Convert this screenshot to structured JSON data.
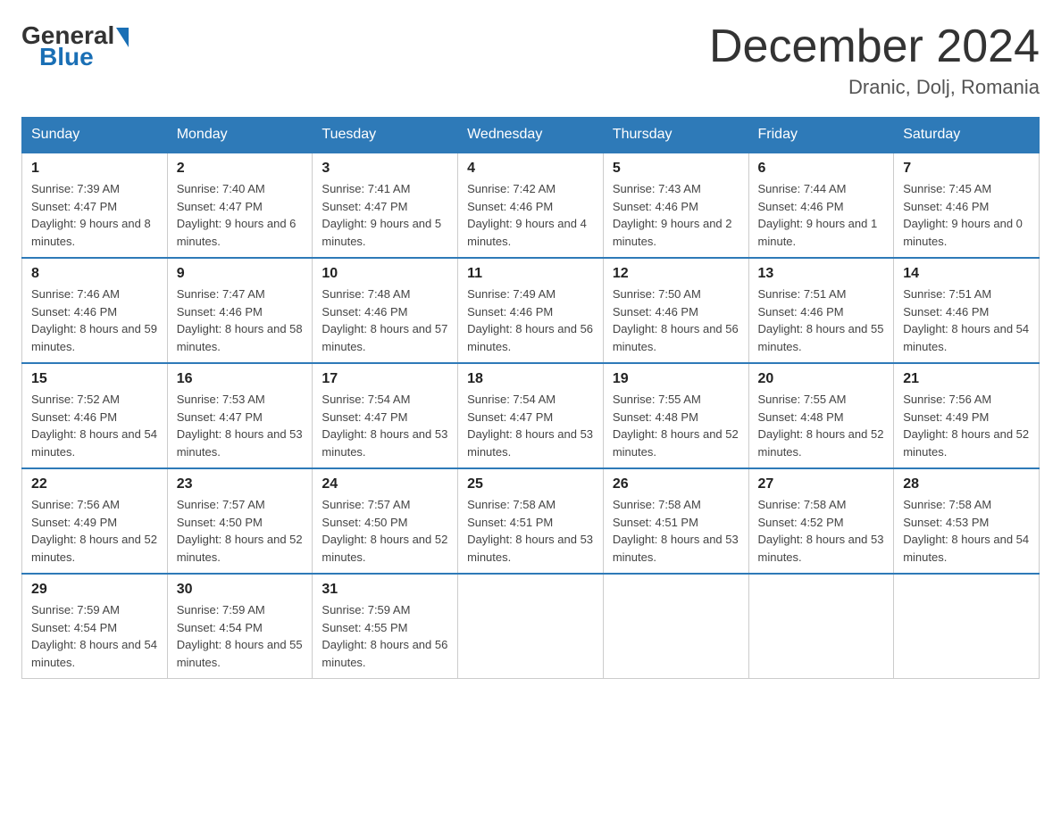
{
  "header": {
    "logo_general": "General",
    "logo_blue": "Blue",
    "month_year": "December 2024",
    "location": "Dranic, Dolj, Romania"
  },
  "weekdays": [
    "Sunday",
    "Monday",
    "Tuesday",
    "Wednesday",
    "Thursday",
    "Friday",
    "Saturday"
  ],
  "weeks": [
    [
      {
        "day": "1",
        "sunrise": "7:39 AM",
        "sunset": "4:47 PM",
        "daylight": "9 hours and 8 minutes."
      },
      {
        "day": "2",
        "sunrise": "7:40 AM",
        "sunset": "4:47 PM",
        "daylight": "9 hours and 6 minutes."
      },
      {
        "day": "3",
        "sunrise": "7:41 AM",
        "sunset": "4:47 PM",
        "daylight": "9 hours and 5 minutes."
      },
      {
        "day": "4",
        "sunrise": "7:42 AM",
        "sunset": "4:46 PM",
        "daylight": "9 hours and 4 minutes."
      },
      {
        "day": "5",
        "sunrise": "7:43 AM",
        "sunset": "4:46 PM",
        "daylight": "9 hours and 2 minutes."
      },
      {
        "day": "6",
        "sunrise": "7:44 AM",
        "sunset": "4:46 PM",
        "daylight": "9 hours and 1 minute."
      },
      {
        "day": "7",
        "sunrise": "7:45 AM",
        "sunset": "4:46 PM",
        "daylight": "9 hours and 0 minutes."
      }
    ],
    [
      {
        "day": "8",
        "sunrise": "7:46 AM",
        "sunset": "4:46 PM",
        "daylight": "8 hours and 59 minutes."
      },
      {
        "day": "9",
        "sunrise": "7:47 AM",
        "sunset": "4:46 PM",
        "daylight": "8 hours and 58 minutes."
      },
      {
        "day": "10",
        "sunrise": "7:48 AM",
        "sunset": "4:46 PM",
        "daylight": "8 hours and 57 minutes."
      },
      {
        "day": "11",
        "sunrise": "7:49 AM",
        "sunset": "4:46 PM",
        "daylight": "8 hours and 56 minutes."
      },
      {
        "day": "12",
        "sunrise": "7:50 AM",
        "sunset": "4:46 PM",
        "daylight": "8 hours and 56 minutes."
      },
      {
        "day": "13",
        "sunrise": "7:51 AM",
        "sunset": "4:46 PM",
        "daylight": "8 hours and 55 minutes."
      },
      {
        "day": "14",
        "sunrise": "7:51 AM",
        "sunset": "4:46 PM",
        "daylight": "8 hours and 54 minutes."
      }
    ],
    [
      {
        "day": "15",
        "sunrise": "7:52 AM",
        "sunset": "4:46 PM",
        "daylight": "8 hours and 54 minutes."
      },
      {
        "day": "16",
        "sunrise": "7:53 AM",
        "sunset": "4:47 PM",
        "daylight": "8 hours and 53 minutes."
      },
      {
        "day": "17",
        "sunrise": "7:54 AM",
        "sunset": "4:47 PM",
        "daylight": "8 hours and 53 minutes."
      },
      {
        "day": "18",
        "sunrise": "7:54 AM",
        "sunset": "4:47 PM",
        "daylight": "8 hours and 53 minutes."
      },
      {
        "day": "19",
        "sunrise": "7:55 AM",
        "sunset": "4:48 PM",
        "daylight": "8 hours and 52 minutes."
      },
      {
        "day": "20",
        "sunrise": "7:55 AM",
        "sunset": "4:48 PM",
        "daylight": "8 hours and 52 minutes."
      },
      {
        "day": "21",
        "sunrise": "7:56 AM",
        "sunset": "4:49 PM",
        "daylight": "8 hours and 52 minutes."
      }
    ],
    [
      {
        "day": "22",
        "sunrise": "7:56 AM",
        "sunset": "4:49 PM",
        "daylight": "8 hours and 52 minutes."
      },
      {
        "day": "23",
        "sunrise": "7:57 AM",
        "sunset": "4:50 PM",
        "daylight": "8 hours and 52 minutes."
      },
      {
        "day": "24",
        "sunrise": "7:57 AM",
        "sunset": "4:50 PM",
        "daylight": "8 hours and 52 minutes."
      },
      {
        "day": "25",
        "sunrise": "7:58 AM",
        "sunset": "4:51 PM",
        "daylight": "8 hours and 53 minutes."
      },
      {
        "day": "26",
        "sunrise": "7:58 AM",
        "sunset": "4:51 PM",
        "daylight": "8 hours and 53 minutes."
      },
      {
        "day": "27",
        "sunrise": "7:58 AM",
        "sunset": "4:52 PM",
        "daylight": "8 hours and 53 minutes."
      },
      {
        "day": "28",
        "sunrise": "7:58 AM",
        "sunset": "4:53 PM",
        "daylight": "8 hours and 54 minutes."
      }
    ],
    [
      {
        "day": "29",
        "sunrise": "7:59 AM",
        "sunset": "4:54 PM",
        "daylight": "8 hours and 54 minutes."
      },
      {
        "day": "30",
        "sunrise": "7:59 AM",
        "sunset": "4:54 PM",
        "daylight": "8 hours and 55 minutes."
      },
      {
        "day": "31",
        "sunrise": "7:59 AM",
        "sunset": "4:55 PM",
        "daylight": "8 hours and 56 minutes."
      },
      null,
      null,
      null,
      null
    ]
  ],
  "labels": {
    "sunrise": "Sunrise:",
    "sunset": "Sunset:",
    "daylight": "Daylight:"
  }
}
